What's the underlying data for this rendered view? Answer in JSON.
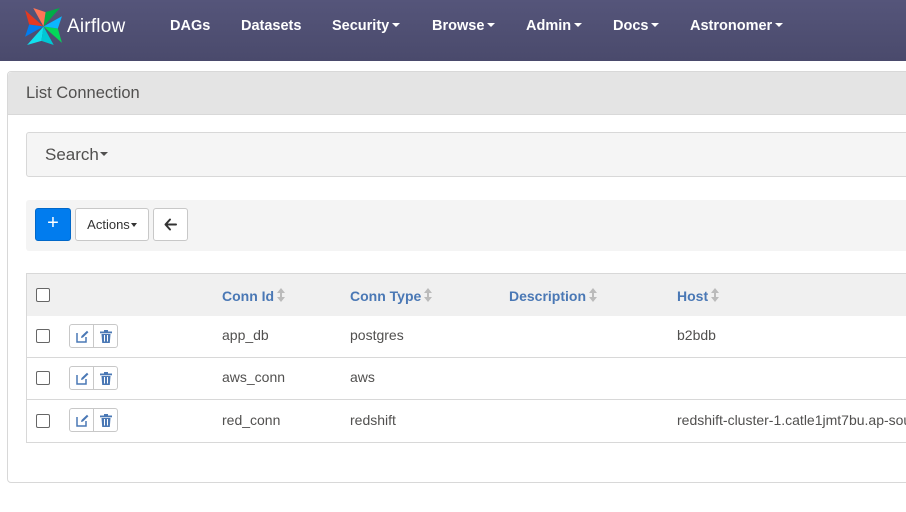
{
  "navbar": {
    "brand": "Airflow",
    "items": [
      {
        "label": "DAGs",
        "dropdown": false
      },
      {
        "label": "Datasets",
        "dropdown": false
      },
      {
        "label": "Security",
        "dropdown": true
      },
      {
        "label": "Browse",
        "dropdown": true
      },
      {
        "label": "Admin",
        "dropdown": true
      },
      {
        "label": "Docs",
        "dropdown": true
      },
      {
        "label": "Astronomer",
        "dropdown": true
      }
    ]
  },
  "page": {
    "title": "List Connection"
  },
  "search": {
    "label": "Search"
  },
  "toolbar": {
    "add_label": "+",
    "actions_label": "Actions",
    "back_icon": "arrow-left-icon"
  },
  "table": {
    "columns": [
      "Conn Id",
      "Conn Type",
      "Description",
      "Host"
    ],
    "rows": [
      {
        "conn_id": "app_db",
        "conn_type": "postgres",
        "description": "",
        "host": "b2bdb"
      },
      {
        "conn_id": "aws_conn",
        "conn_type": "aws",
        "description": "",
        "host": ""
      },
      {
        "conn_id": "red_conn",
        "conn_type": "redshift",
        "description": "",
        "host": "redshift-cluster-1.catle1jmt7bu.ap-sou"
      }
    ],
    "row_icons": [
      "edit-icon",
      "trash-icon"
    ]
  },
  "colors": {
    "navbar": "#4d4e72",
    "primary": "#017cee",
    "link": "#4a78b5"
  }
}
